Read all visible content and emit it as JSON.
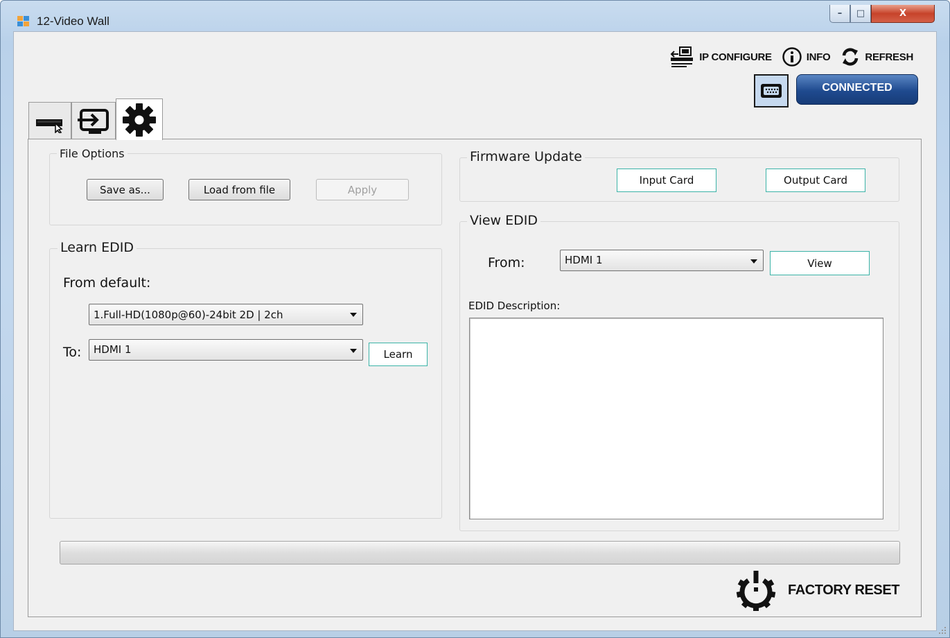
{
  "window": {
    "title": "12-Video Wall",
    "controls": {
      "minimize": "–",
      "maximize": "□",
      "close": "X"
    }
  },
  "toolbar": {
    "ip_configure": "IP CONFIGURE",
    "info": "INFO",
    "refresh": "REFRESH",
    "connected": "CONNECTED"
  },
  "tabs": [
    {
      "icon": "keyboard-mouse-icon"
    },
    {
      "icon": "input-monitor-icon"
    },
    {
      "icon": "gear-icon",
      "selected": true
    }
  ],
  "file_options": {
    "title": "File Options",
    "save_as": "Save as...",
    "load_from_file": "Load from file",
    "apply": "Apply"
  },
  "learn_edid": {
    "title": "Learn EDID",
    "from_default_label": "From default:",
    "from_default_value": "1.Full-HD(1080p@60)-24bit 2D | 2ch",
    "to_label": "To:",
    "to_value": "HDMI 1",
    "learn": "Learn"
  },
  "firmware_update": {
    "title": "Firmware Update",
    "input_card": "Input Card",
    "output_card": "Output Card"
  },
  "view_edid": {
    "title": "View EDID",
    "from_label": "From:",
    "from_value": "HDMI 1",
    "view": "View",
    "description_label": "EDID Description:",
    "description_value": ""
  },
  "progress": {
    "value": 0
  },
  "factory_reset": {
    "label": "FACTORY RESET"
  },
  "colors": {
    "connected_button": "#1f4a8f",
    "flat_button_border": "#3bb3a7",
    "client_bg": "#f0f0f0"
  }
}
